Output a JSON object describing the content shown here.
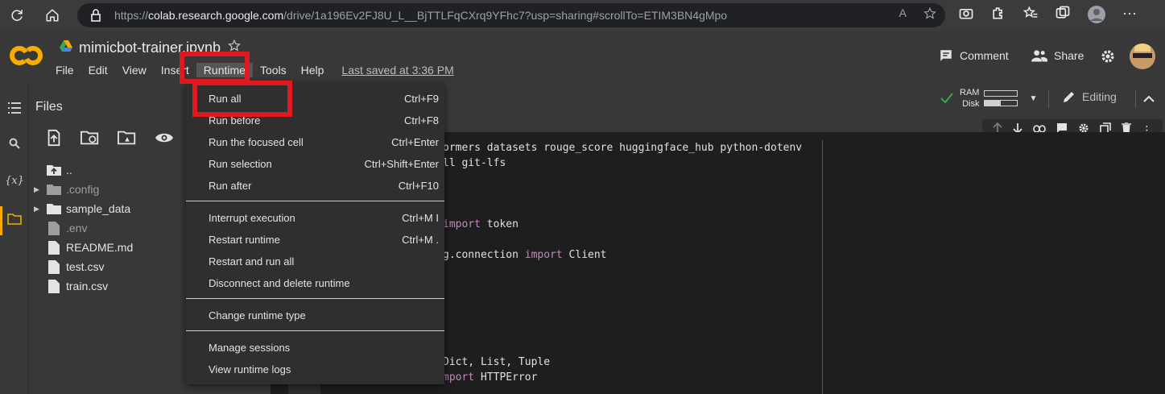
{
  "browser": {
    "url_prefix": "https://",
    "url_host": "colab.research.google.com",
    "url_path": "/drive/1a196Ev2FJ8U_L__BjTTLFqCXrq9YFhc7?usp=sharing#scrollTo=ETIM3BN4gMpo"
  },
  "header": {
    "logo_text": "CO",
    "notebook_name": "mimicbot-trainer.ipynb",
    "menu": [
      "File",
      "Edit",
      "View",
      "Insert",
      "Runtime",
      "Tools",
      "Help"
    ],
    "last_saved": "Last saved at 3:36 PM",
    "comment_label": "Comment",
    "share_label": "Share"
  },
  "files_panel": {
    "title": "Files",
    "items": [
      {
        "name": "..",
        "type": "parent"
      },
      {
        "name": ".config",
        "type": "folder",
        "dim": true
      },
      {
        "name": "sample_data",
        "type": "folder",
        "dim": false
      },
      {
        "name": ".env",
        "type": "file",
        "dim": true
      },
      {
        "name": "README.md",
        "type": "file",
        "dim": false
      },
      {
        "name": "test.csv",
        "type": "file",
        "dim": false
      },
      {
        "name": "train.csv",
        "type": "file",
        "dim": false
      }
    ]
  },
  "resources": {
    "ram_label": "RAM",
    "disk_label": "Disk",
    "ram_usage": 0.0,
    "disk_usage": 0.5,
    "editing_label": "Editing"
  },
  "code": {
    "lines": [
      {
        "text": "ormers datasets rouge_score huggingface_hub python-dotenv"
      },
      {
        "text": "ll git-lfs"
      },
      {
        "pre": "",
        "kw": "import",
        "post": " token"
      },
      {
        "pre": "g.connection ",
        "kw": "import",
        "post": " Client"
      },
      {
        "text": "Dict, List, Tuple"
      },
      {
        "pre": "",
        "kw": "mport",
        "post": " HTTPError"
      }
    ]
  },
  "runtime_menu": {
    "groups": [
      [
        {
          "label": "Run all",
          "shortcut": "Ctrl+F9"
        },
        {
          "label": "Run before",
          "shortcut": "Ctrl+F8"
        },
        {
          "label": "Run the focused cell",
          "shortcut": "Ctrl+Enter"
        },
        {
          "label": "Run selection",
          "shortcut": "Ctrl+Shift+Enter"
        },
        {
          "label": "Run after",
          "shortcut": "Ctrl+F10"
        }
      ],
      [
        {
          "label": "Interrupt execution",
          "shortcut": "Ctrl+M I"
        },
        {
          "label": "Restart runtime",
          "shortcut": "Ctrl+M ."
        },
        {
          "label": "Restart and run all",
          "shortcut": ""
        },
        {
          "label": "Disconnect and delete runtime",
          "shortcut": ""
        }
      ],
      [
        {
          "label": "Change runtime type",
          "shortcut": ""
        }
      ],
      [
        {
          "label": "Manage sessions",
          "shortcut": ""
        },
        {
          "label": "View runtime logs",
          "shortcut": ""
        }
      ]
    ]
  },
  "colors": {
    "accent": "#f9ab00",
    "highlight": "#e0181f",
    "keyword": "#c586c0",
    "check": "#34a853"
  }
}
